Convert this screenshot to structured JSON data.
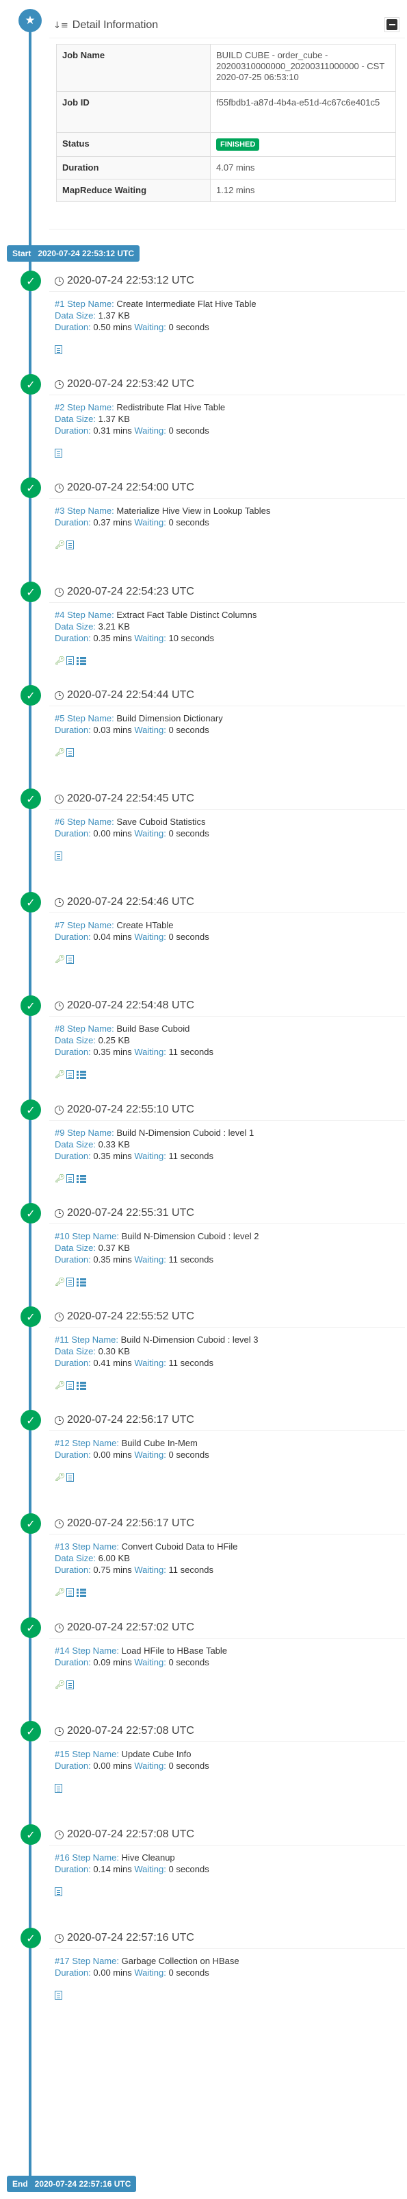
{
  "detail": {
    "title": "Detail Information",
    "rows": [
      {
        "key": "Job Name",
        "value": "BUILD CUBE - order_cube - 20200310000000_20200311000000 - CST 2020-07-25 06:53:10"
      },
      {
        "key": "Job ID",
        "value": "f55fbdb1-a87d-4b4a-e51d-4c67c6e401c5"
      },
      {
        "key": "Status",
        "value": "FINISHED"
      },
      {
        "key": "Duration",
        "value": "4.07 mins"
      },
      {
        "key": "MapReduce Waiting",
        "value": "1.12 mins"
      }
    ]
  },
  "colors": {
    "accent": "#3c8dbc",
    "success": "#00a65a",
    "icon_green": "#6aa84f"
  },
  "start": {
    "label": "Start",
    "time": "2020-07-24 22:53:12 UTC"
  },
  "end": {
    "label": "End",
    "time": "2020-07-24 22:57:16 UTC"
  },
  "labels": {
    "step_name": "Step Name:",
    "data_size": "Data Size:",
    "duration": "Duration:",
    "waiting": "Waiting:"
  },
  "steps": [
    {
      "time": "2020-07-24 22:53:12 UTC",
      "num": "#1",
      "name": "Create Intermediate Flat Hive Table",
      "data_size": "1.37 KB",
      "duration": "0.50 mins",
      "waiting": "0 seconds",
      "icons": [
        "doc-icon"
      ]
    },
    {
      "time": "2020-07-24 22:53:42 UTC",
      "num": "#2",
      "name": "Redistribute Flat Hive Table",
      "data_size": "1.37 KB",
      "duration": "0.31 mins",
      "waiting": "0 seconds",
      "icons": [
        "doc-icon"
      ]
    },
    {
      "time": "2020-07-24 22:54:00 UTC",
      "num": "#3",
      "name": "Materialize Hive View in Lookup Tables",
      "data_size": null,
      "duration": "0.37 mins",
      "waiting": "0 seconds",
      "icons": [
        "key-icon",
        "doc-icon"
      ]
    },
    {
      "time": "2020-07-24 22:54:23 UTC",
      "num": "#4",
      "name": "Extract Fact Table Distinct Columns",
      "data_size": "3.21 KB",
      "duration": "0.35 mins",
      "waiting": "10 seconds",
      "icons": [
        "key-icon",
        "doc-icon",
        "tasks-icon"
      ]
    },
    {
      "time": "2020-07-24 22:54:44 UTC",
      "num": "#5",
      "name": "Build Dimension Dictionary",
      "data_size": null,
      "duration": "0.03 mins",
      "waiting": "0 seconds",
      "icons": [
        "key-icon",
        "doc-icon"
      ]
    },
    {
      "time": "2020-07-24 22:54:45 UTC",
      "num": "#6",
      "name": "Save Cuboid Statistics",
      "data_size": null,
      "duration": "0.00 mins",
      "waiting": "0 seconds",
      "icons": [
        "doc-icon"
      ]
    },
    {
      "time": "2020-07-24 22:54:46 UTC",
      "num": "#7",
      "name": "Create HTable",
      "data_size": null,
      "duration": "0.04 mins",
      "waiting": "0 seconds",
      "icons": [
        "key-icon",
        "doc-icon"
      ]
    },
    {
      "time": "2020-07-24 22:54:48 UTC",
      "num": "#8",
      "name": "Build Base Cuboid",
      "data_size": "0.25 KB",
      "duration": "0.35 mins",
      "waiting": "11 seconds",
      "icons": [
        "key-icon",
        "doc-icon",
        "tasks-icon"
      ]
    },
    {
      "time": "2020-07-24 22:55:10 UTC",
      "num": "#9",
      "name": "Build N-Dimension Cuboid : level 1",
      "data_size": "0.33 KB",
      "duration": "0.35 mins",
      "waiting": "11 seconds",
      "icons": [
        "key-icon",
        "doc-icon",
        "tasks-icon"
      ]
    },
    {
      "time": "2020-07-24 22:55:31 UTC",
      "num": "#10",
      "name": "Build N-Dimension Cuboid : level 2",
      "data_size": "0.37 KB",
      "duration": "0.35 mins",
      "waiting": "11 seconds",
      "icons": [
        "key-icon",
        "doc-icon",
        "tasks-icon"
      ]
    },
    {
      "time": "2020-07-24 22:55:52 UTC",
      "num": "#11",
      "name": "Build N-Dimension Cuboid : level 3",
      "data_size": "0.30 KB",
      "duration": "0.41 mins",
      "waiting": "11 seconds",
      "icons": [
        "key-icon",
        "doc-icon",
        "tasks-icon"
      ]
    },
    {
      "time": "2020-07-24 22:56:17 UTC",
      "num": "#12",
      "name": "Build Cube In-Mem",
      "data_size": null,
      "duration": "0.00 mins",
      "waiting": "0 seconds",
      "icons": [
        "key-icon",
        "doc-icon"
      ]
    },
    {
      "time": "2020-07-24 22:56:17 UTC",
      "num": "#13",
      "name": "Convert Cuboid Data to HFile",
      "data_size": "6.00 KB",
      "duration": "0.75 mins",
      "waiting": "11 seconds",
      "icons": [
        "key-icon",
        "doc-icon",
        "tasks-icon"
      ]
    },
    {
      "time": "2020-07-24 22:57:02 UTC",
      "num": "#14",
      "name": "Load HFile to HBase Table",
      "data_size": null,
      "duration": "0.09 mins",
      "waiting": "0 seconds",
      "icons": [
        "key-icon",
        "doc-icon"
      ]
    },
    {
      "time": "2020-07-24 22:57:08 UTC",
      "num": "#15",
      "name": "Update Cube Info",
      "data_size": null,
      "duration": "0.00 mins",
      "waiting": "0 seconds",
      "icons": [
        "doc-icon"
      ]
    },
    {
      "time": "2020-07-24 22:57:08 UTC",
      "num": "#16",
      "name": "Hive Cleanup",
      "data_size": null,
      "duration": "0.14 mins",
      "waiting": "0 seconds",
      "icons": [
        "doc-icon"
      ]
    },
    {
      "time": "2020-07-24 22:57:16 UTC",
      "num": "#17",
      "name": "Garbage Collection on HBase",
      "data_size": null,
      "duration": "0.00 mins",
      "waiting": "0 seconds",
      "icons": [
        "doc-icon"
      ]
    }
  ]
}
